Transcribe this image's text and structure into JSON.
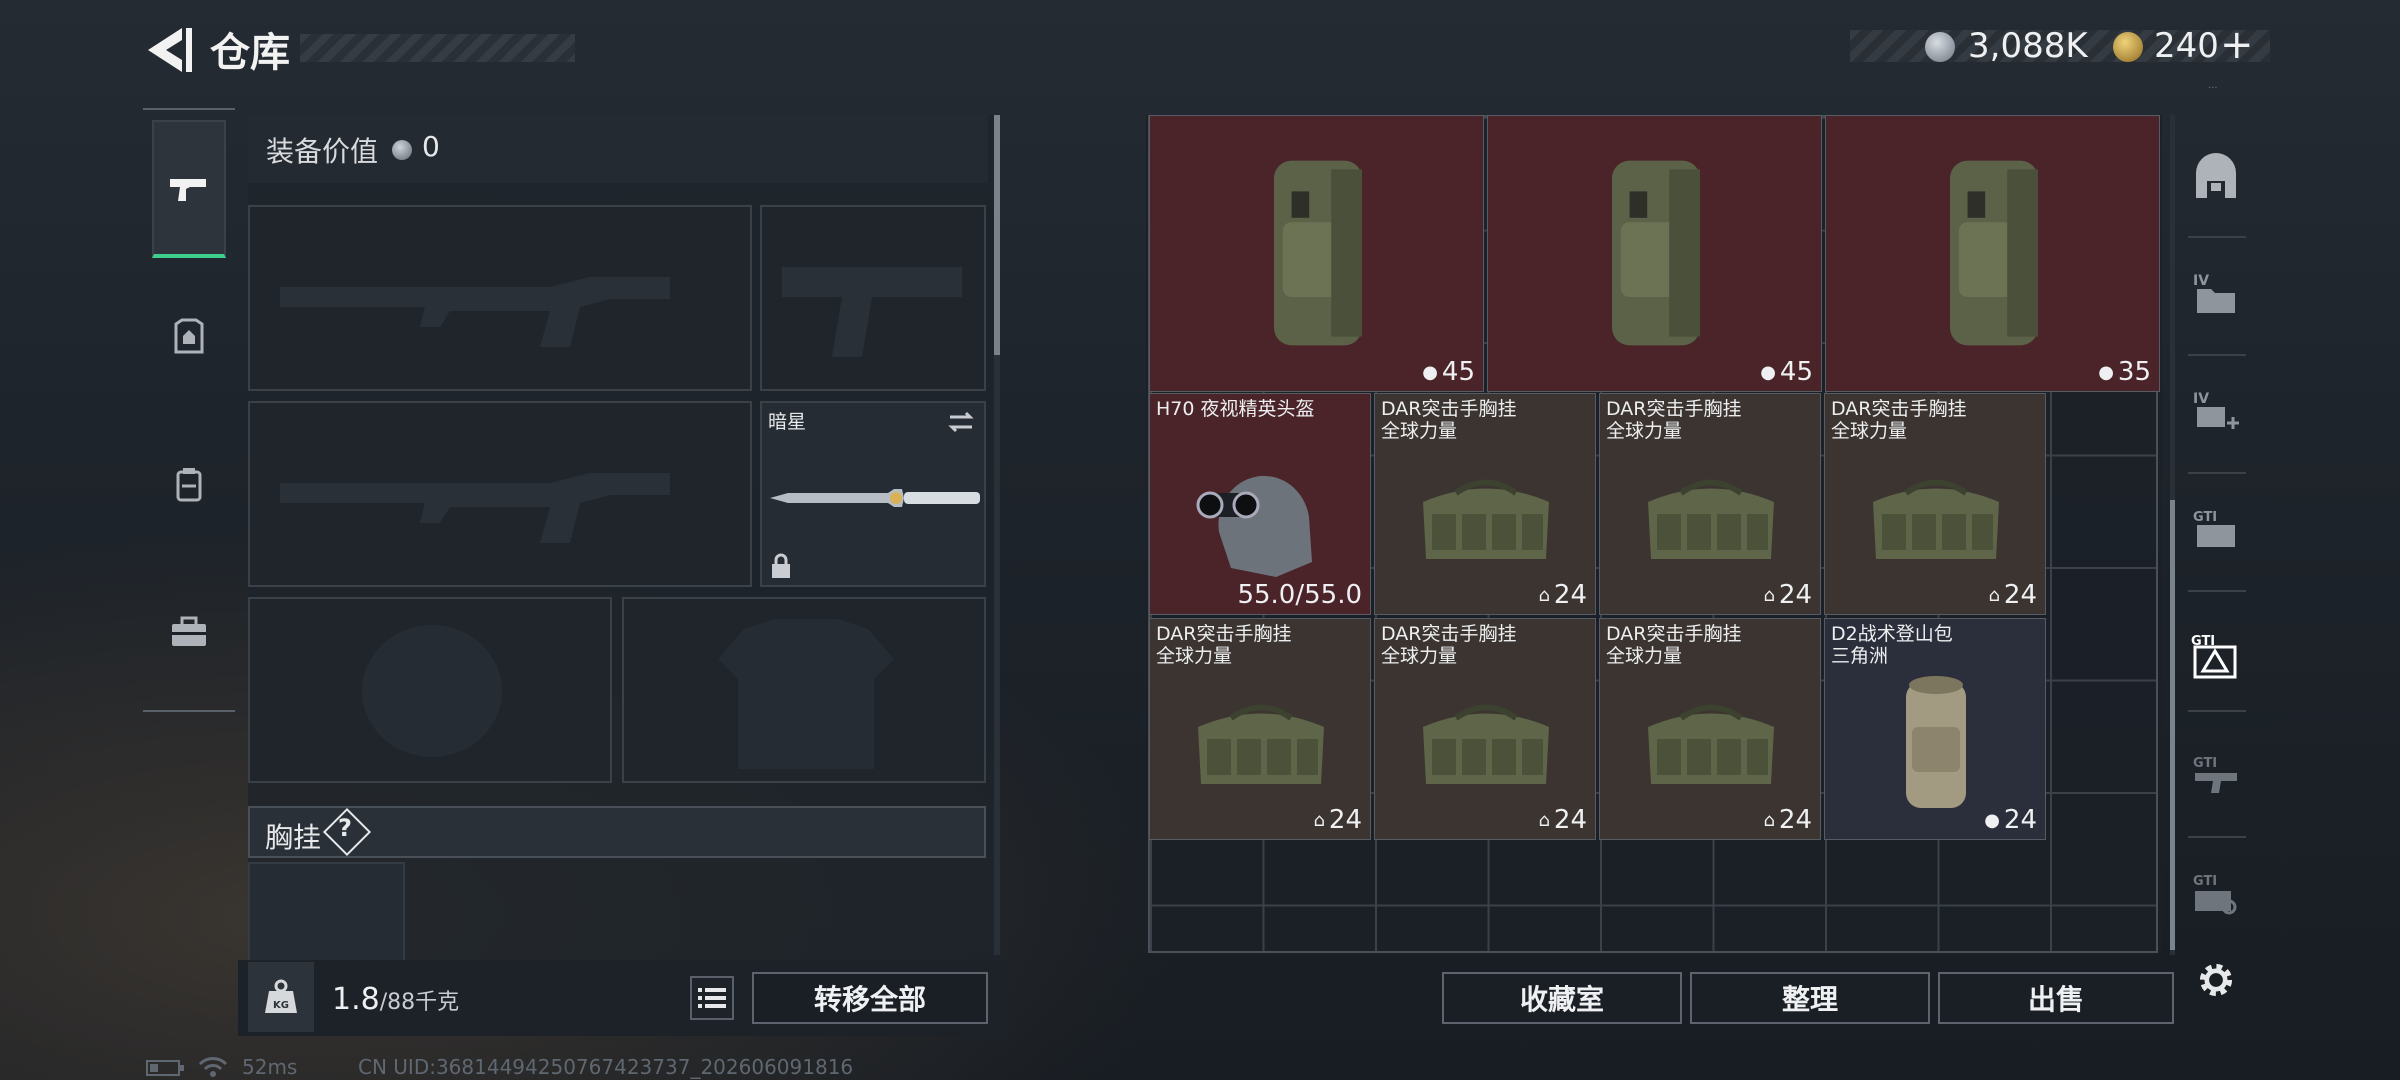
{
  "header": {
    "title": "仓库",
    "silver": "3,088K",
    "gold": "240",
    "gold_plus": "+",
    "version": "..."
  },
  "left": {
    "value_label": "装备价值",
    "value": "0",
    "knife_name": "暗星",
    "chest_label": "胸挂",
    "chest_help": "?",
    "weight_current": "1.8",
    "weight_max": "/88千克",
    "transfer_all": "转移全部"
  },
  "items": [
    {
      "name": "",
      "count": "45",
      "icon": "backpack-icon",
      "bg": "red"
    },
    {
      "name": "",
      "count": "45",
      "icon": "backpack-icon",
      "bg": "red"
    },
    {
      "name": "",
      "count": "35",
      "icon": "backpack-icon",
      "bg": "red"
    },
    {
      "name": "H70 夜视精英头盔",
      "count": "55.0/55.0",
      "icon": "helmet-icon",
      "bg": "red"
    },
    {
      "name": "DAR突击手胸挂\n全球力量",
      "count": "24",
      "icon": "chest-rig-icon",
      "bg": "brown"
    },
    {
      "name": "DAR突击手胸挂\n全球力量",
      "count": "24",
      "icon": "chest-rig-icon",
      "bg": "brown"
    },
    {
      "name": "DAR突击手胸挂\n全球力量",
      "count": "24",
      "icon": "chest-rig-icon",
      "bg": "brown"
    },
    {
      "name": "DAR突击手胸挂\n全球力量",
      "count": "24",
      "icon": "chest-rig-icon",
      "bg": "brown"
    },
    {
      "name": "DAR突击手胸挂\n全球力量",
      "count": "24",
      "icon": "chest-rig-icon",
      "bg": "brown"
    },
    {
      "name": "DAR突击手胸挂\n全球力量",
      "count": "24",
      "icon": "chest-rig-icon",
      "bg": "brown"
    },
    {
      "name": "D2战术登山包\n三角洲",
      "count": "24",
      "icon": "backpack-icon",
      "bg": "blue"
    }
  ],
  "buttons": {
    "collection": "收藏室",
    "organize": "整理",
    "sell": "出售"
  },
  "status": {
    "ping": "52ms",
    "uid": "CN UID:3681449425076742373​7_202606091816"
  }
}
